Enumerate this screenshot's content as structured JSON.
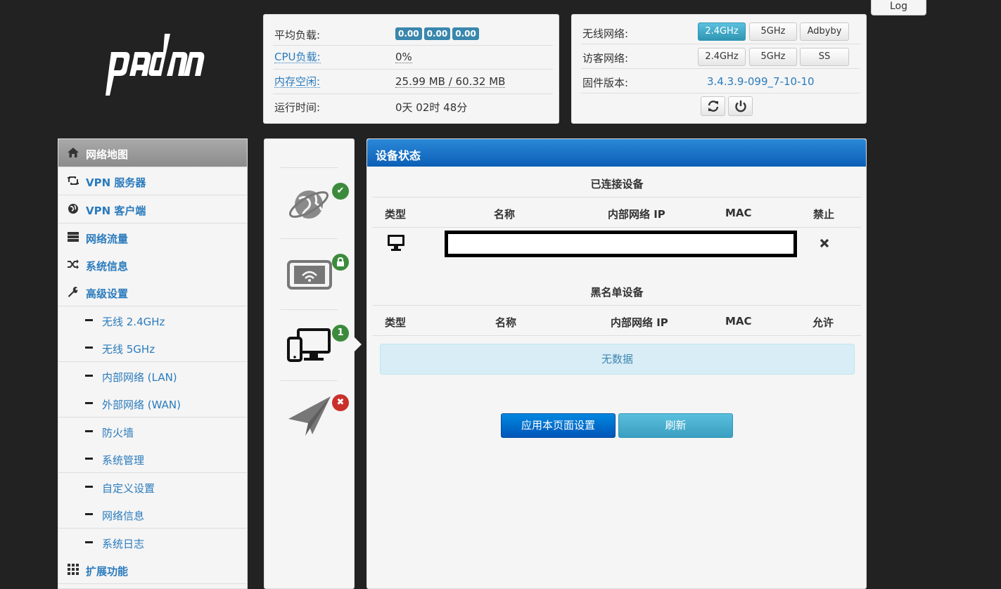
{
  "header": {
    "logo_text": "padavan",
    "log_button": "Log"
  },
  "info": {
    "load_label": "平均负载:",
    "load_values": [
      "0.00",
      "0.00",
      "0.00"
    ],
    "cpu_label": "CPU负载:",
    "cpu_value": "0%",
    "mem_label": "内存空闲:",
    "mem_value": "25.99 MB / 60.32 MB",
    "uptime_label": "运行时间:",
    "uptime_value": "0天 02时 48分"
  },
  "wifi": {
    "wireless_label": "无线网络:",
    "wireless_buttons": [
      "2.4GHz",
      "5GHz",
      "Adbyby"
    ],
    "guest_label": "访客网络:",
    "guest_buttons": [
      "2.4GHz",
      "5GHz",
      "SS"
    ],
    "firmware_label": "固件版本:",
    "firmware_value": "3.4.3.9-099_7-10-10",
    "refresh_icon": "refresh-icon",
    "power_icon": "power-icon"
  },
  "sidebar": {
    "items": [
      {
        "label": "网络地图",
        "icon": "home-icon"
      },
      {
        "label": "VPN 服务器",
        "icon": "retweet-icon"
      },
      {
        "label": "VPN 客户端",
        "icon": "globe-icon"
      },
      {
        "label": "网络流量",
        "icon": "server-icon"
      },
      {
        "label": "系统信息",
        "icon": "random-icon"
      },
      {
        "label": "高级设置",
        "icon": "wrench-icon"
      }
    ],
    "sub_items": [
      "无线 2.4GHz",
      "无线 5GHz",
      "内部网络 (LAN)",
      "外部网络 (WAN)",
      "防火墙",
      "系统管理",
      "自定义设置",
      "网络信息",
      "系统日志"
    ],
    "ext_label": "扩展功能"
  },
  "status_icons": {
    "internet_badge": "✔",
    "guest_badge": "lock",
    "clients_badge": "1",
    "usb_badge": "✖"
  },
  "main": {
    "title": "设备状态",
    "connected_title": "已连接设备",
    "blacklist_title": "黑名单设备",
    "connected_headers": [
      "类型",
      "名称",
      "内部网络 IP",
      "MAC",
      "禁止"
    ],
    "blacklist_headers": [
      "类型",
      "名称",
      "内部网络 IP",
      "MAC",
      "允许"
    ],
    "no_data": "无数据",
    "apply_button": "应用本页面设置",
    "refresh_button": "刷新"
  },
  "colors": {
    "accent": "#2a7bbd",
    "header_blue": "#0b5fb6",
    "success": "#3c8b3c",
    "danger": "#c9302c"
  }
}
